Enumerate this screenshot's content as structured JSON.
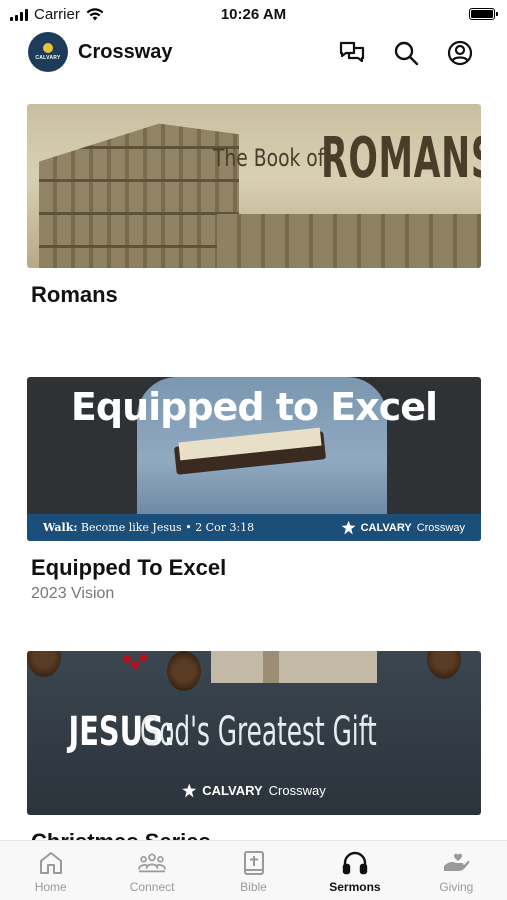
{
  "status_bar": {
    "carrier": "Carrier",
    "time": "10:26 AM"
  },
  "header": {
    "app_name": "Crossway",
    "logo_text": "CALVARY",
    "icons": [
      "chat-icon",
      "search-icon",
      "account-icon"
    ]
  },
  "sermons": [
    {
      "title": "Romans",
      "subtitle": "",
      "banner": {
        "line1": "The Book of",
        "line2": "ROMANS"
      }
    },
    {
      "title": "Equipped To Excel",
      "subtitle": "2023 Vision",
      "banner": {
        "headline": "Equipped to Excel",
        "walk_label": "Walk:",
        "walk_text": "Become like Jesus • 2 Cor 3:18",
        "brand_bold": "CALVARY",
        "brand_light": "Crossway"
      }
    },
    {
      "title": "Christmas Series",
      "subtitle": "",
      "banner": {
        "headline_bold": "JESUS:",
        "headline_light": "God's Greatest Gift",
        "brand_bold": "CALVARY",
        "brand_light": "Crossway"
      }
    }
  ],
  "tabs": [
    {
      "label": "Home",
      "icon": "home-icon",
      "active": false
    },
    {
      "label": "Connect",
      "icon": "people-icon",
      "active": false
    },
    {
      "label": "Bible",
      "icon": "bible-icon",
      "active": false
    },
    {
      "label": "Sermons",
      "icon": "headphones-icon",
      "active": true
    },
    {
      "label": "Giving",
      "icon": "giving-hand-icon",
      "active": false
    }
  ],
  "colors": {
    "brand_blue": "#1c4e7a",
    "active_tab": "#111111",
    "inactive_tab": "#9a9a9a"
  }
}
